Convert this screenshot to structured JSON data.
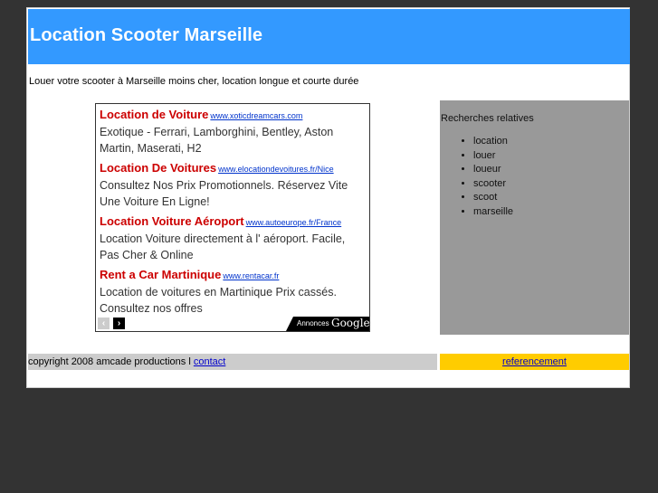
{
  "header": {
    "title": "Location Scooter Marseille"
  },
  "tagline": "Louer votre scooter à Marseille moins cher, location longue et courte durée",
  "ads": {
    "items": [
      {
        "title": "Location de Voiture",
        "url": "www.xoticdreamcars.com",
        "desc": "Exotique - Ferrari, Lamborghini, Bentley, Aston Martin, Maserati, H2"
      },
      {
        "title": "Location De Voitures",
        "url": "www.elocationdevoitures.fr/Nice",
        "desc": "Consultez Nos Prix Promotionnels. Réservez Vite Une Voiture En Ligne!"
      },
      {
        "title": "Location Voiture Aéroport",
        "url": "www.autoeurope.fr/France",
        "desc": "Location Voiture directement à l' aéroport. Facile, Pas Cher & Online"
      },
      {
        "title": "Rent a Car Martinique",
        "url": "www.rentacar.fr",
        "desc": "Location de voitures en Martinique Prix cassés. Consultez nos offres"
      }
    ],
    "prev_icon": "‹",
    "next_icon": "›",
    "badge_label": "Annonces",
    "badge_brand": "Google"
  },
  "sidebar": {
    "title": "Recherches relatives",
    "items": [
      "location",
      "louer",
      "loueur",
      "scooter",
      "scoot",
      "marseille"
    ]
  },
  "footer": {
    "copyright": "copyright 2008 amcade productions l ",
    "contact_link": "contact",
    "referencement_link": "referencement"
  },
  "colors": {
    "header_bg": "#3399ff",
    "ad_title": "#cc0000",
    "sidebar_bg": "#999999",
    "footer_right_bg": "#ffcc00"
  }
}
